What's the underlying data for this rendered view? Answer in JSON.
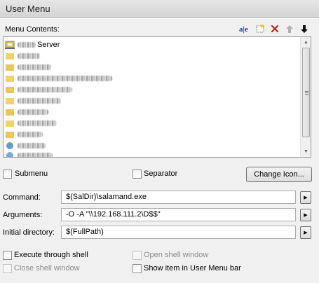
{
  "window": {
    "title": "User Menu"
  },
  "menu_contents": {
    "label": "Menu Contents:",
    "toolbar": {
      "rename_label": "a|e"
    },
    "first_item": "Server"
  },
  "options": {
    "submenu": "Submenu",
    "separator": "Separator",
    "change_icon": "Change Icon..."
  },
  "fields": {
    "command": {
      "label": "Command:",
      "value": "$(SalDir)\\salamand.exe"
    },
    "arguments": {
      "label": "Arguments:",
      "value": "-O -A \"\\\\192.168.111.2\\D$$\""
    },
    "initial_directory": {
      "label": "Initial directory:",
      "value": "$(FullPath)"
    }
  },
  "checkboxes": {
    "execute_through_shell": "Execute through shell",
    "open_shell_window": "Open shell window",
    "close_shell_window": "Close shell window",
    "show_in_bar": "Show item in User Menu bar"
  }
}
